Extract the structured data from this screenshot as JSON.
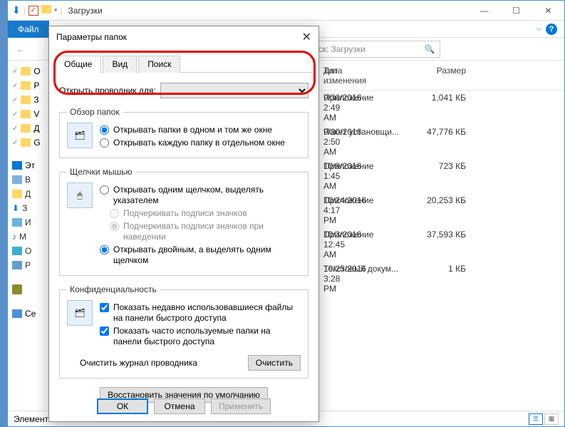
{
  "window": {
    "title": "Загрузки",
    "file_tab": "Файл",
    "search_placeholder": "Поиск: Загрузки",
    "status": "Элементь"
  },
  "sidebar": {
    "items": [
      "О",
      "Р",
      "З",
      "V",
      "Д",
      "G"
    ],
    "this_pc": "Эт",
    "disks": [
      "В",
      "Д",
      "З",
      "И",
      "М",
      "О",
      "Р"
    ],
    "net": "Се"
  },
  "columns": {
    "date": "Дата изменения",
    "type": "Тип",
    "size": "Размер"
  },
  "files": [
    {
      "date": "9/30/2016 2:49 AM",
      "type": "Приложение",
      "size": "1,041 КБ"
    },
    {
      "date": "9/30/2016 2:50 AM",
      "type": "Пакет установщи...",
      "size": "47,776 КБ"
    },
    {
      "date": "10/9/2016 1:45 AM",
      "type": "Приложение",
      "size": "723 КБ"
    },
    {
      "date": "10/24/2016 4:17 PM",
      "type": "Приложение",
      "size": "20,253 КБ"
    },
    {
      "date": "10/3/2016 12:45 AM",
      "type": "Приложение",
      "size": "37,593 КБ"
    },
    {
      "date": "10/25/2016 3:28 PM",
      "type": "Текстовый докум...",
      "size": "1 КБ"
    }
  ],
  "dialog": {
    "title": "Параметры папок",
    "tabs": {
      "general": "Общие",
      "view": "Вид",
      "search": "Поиск"
    },
    "open_for_label": "Открыть проводник для:",
    "browse_folders": {
      "legend": "Обзор папок",
      "opt1": "Открывать папки в одном и том же окне",
      "opt2": "Открывать каждую папку в отдельном окне"
    },
    "click_items": {
      "legend": "Щелчки мышью",
      "opt1": "Открывать одним щелчком, выделять указателем",
      "sub1": "Подчеркивать подписи значков",
      "sub2": "Подчеркивать подписи значков при наведении",
      "opt2": "Открывать двойным, а выделять одним щелчком"
    },
    "privacy": {
      "legend": "Конфиденциальность",
      "chk1": "Показать недавно использовавшиеся файлы на панели быстрого доступа",
      "chk2": "Показать часто используемые папки на панели быстрого доступа",
      "clear_label": "Очистить журнал проводника",
      "clear_btn": "Очистить"
    },
    "restore": "Восстановить значения по умолчанию",
    "ok": "ОК",
    "cancel": "Отмена",
    "apply": "Применить"
  }
}
